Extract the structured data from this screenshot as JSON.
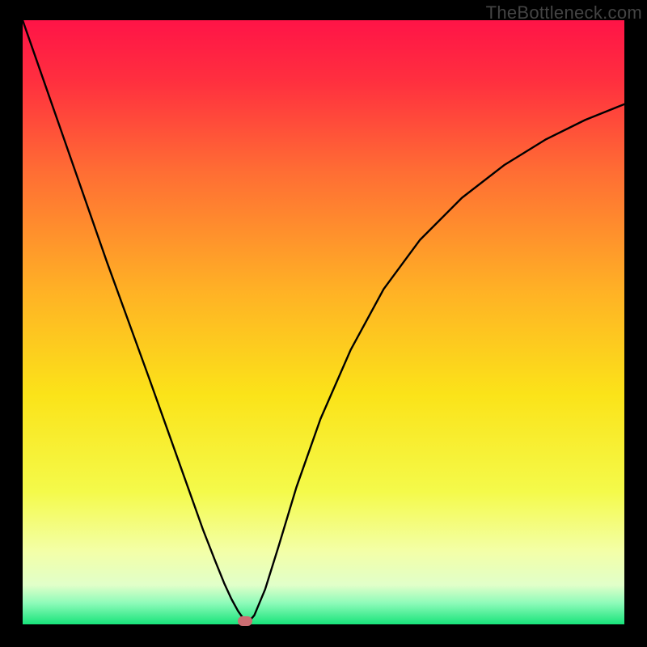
{
  "watermark": {
    "text": "TheBottleneck.com"
  },
  "chart_data": {
    "type": "line",
    "title": "",
    "xlabel": "",
    "ylabel": "",
    "xlim": [
      0,
      100
    ],
    "ylim": [
      0,
      100
    ],
    "gradient_stops": [
      {
        "offset": 0.0,
        "color": "#ff1447"
      },
      {
        "offset": 0.1,
        "color": "#ff2f3f"
      },
      {
        "offset": 0.25,
        "color": "#ff6d34"
      },
      {
        "offset": 0.45,
        "color": "#ffb225"
      },
      {
        "offset": 0.62,
        "color": "#fbe319"
      },
      {
        "offset": 0.78,
        "color": "#f4fa4a"
      },
      {
        "offset": 0.88,
        "color": "#f3ffa8"
      },
      {
        "offset": 0.935,
        "color": "#e1ffc9"
      },
      {
        "offset": 0.965,
        "color": "#8dfbb9"
      },
      {
        "offset": 1.0,
        "color": "#18e37a"
      }
    ],
    "series": [
      {
        "name": "bottleneck-curve",
        "x": [
          0.0,
          3.5,
          7.0,
          10.5,
          14.0,
          17.5,
          21.0,
          24.5,
          27.5,
          30.0,
          32.0,
          33.5,
          34.7,
          35.8,
          36.8,
          37.2,
          38.5,
          40.3,
          42.5,
          45.5,
          49.5,
          54.5,
          60.0,
          66.0,
          73.0,
          80.0,
          87.0,
          93.5,
          100.0
        ],
        "y": [
          100.0,
          90.0,
          80.0,
          70.0,
          60.0,
          50.4,
          40.8,
          31.0,
          22.6,
          15.6,
          10.5,
          6.8,
          4.2,
          2.2,
          0.8,
          0.0,
          1.5,
          5.8,
          12.8,
          22.7,
          34.0,
          45.4,
          55.5,
          63.6,
          70.6,
          76.0,
          80.3,
          83.5,
          86.1
        ]
      }
    ],
    "marker": {
      "x": 37.0,
      "y": 0.6,
      "color": "#cc6d72"
    }
  }
}
